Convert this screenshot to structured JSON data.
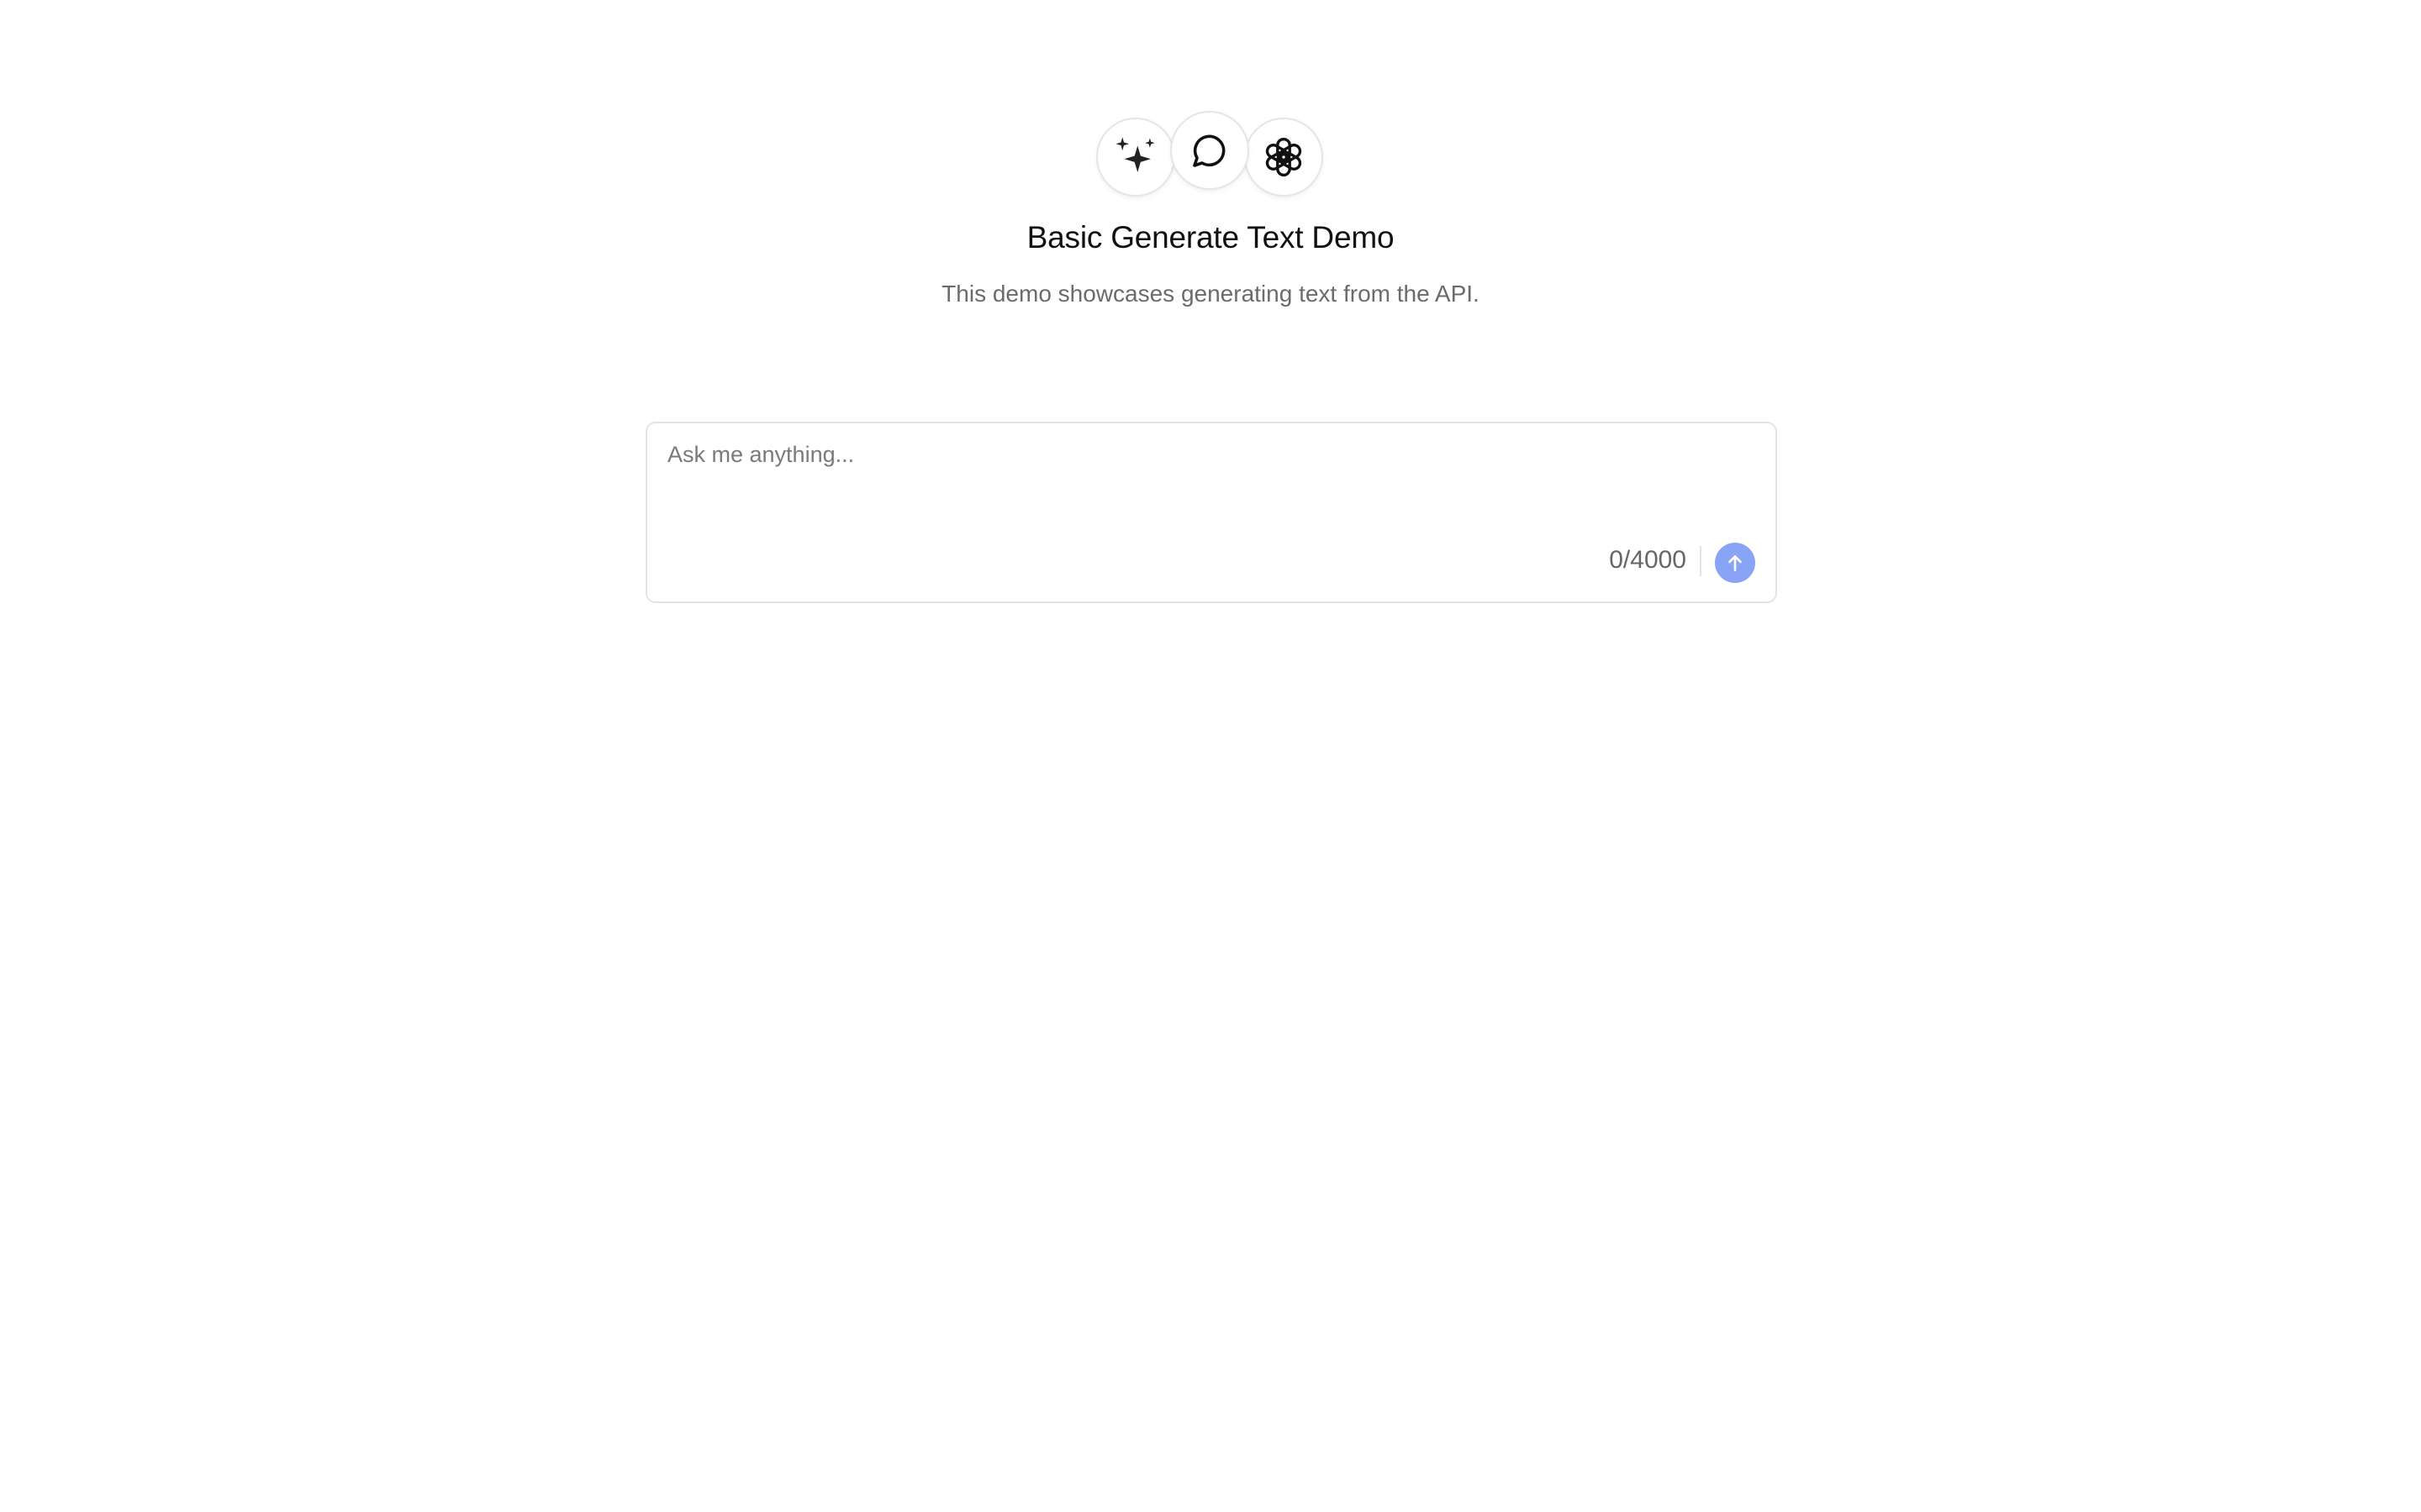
{
  "header": {
    "icons": [
      "sparkles-icon",
      "chat-bubble-icon",
      "openai-logo-icon"
    ],
    "title": "Basic Generate Text Demo",
    "subtitle": "This demo showcases generating text from the API."
  },
  "composer": {
    "placeholder": "Ask me anything...",
    "value": "",
    "counter": "0/4000",
    "send_icon": "arrow-up-icon"
  },
  "colors": {
    "send_button": "#8aa4f5",
    "border": "#e3e3e3",
    "subtitle_text": "#6b6b6b"
  }
}
